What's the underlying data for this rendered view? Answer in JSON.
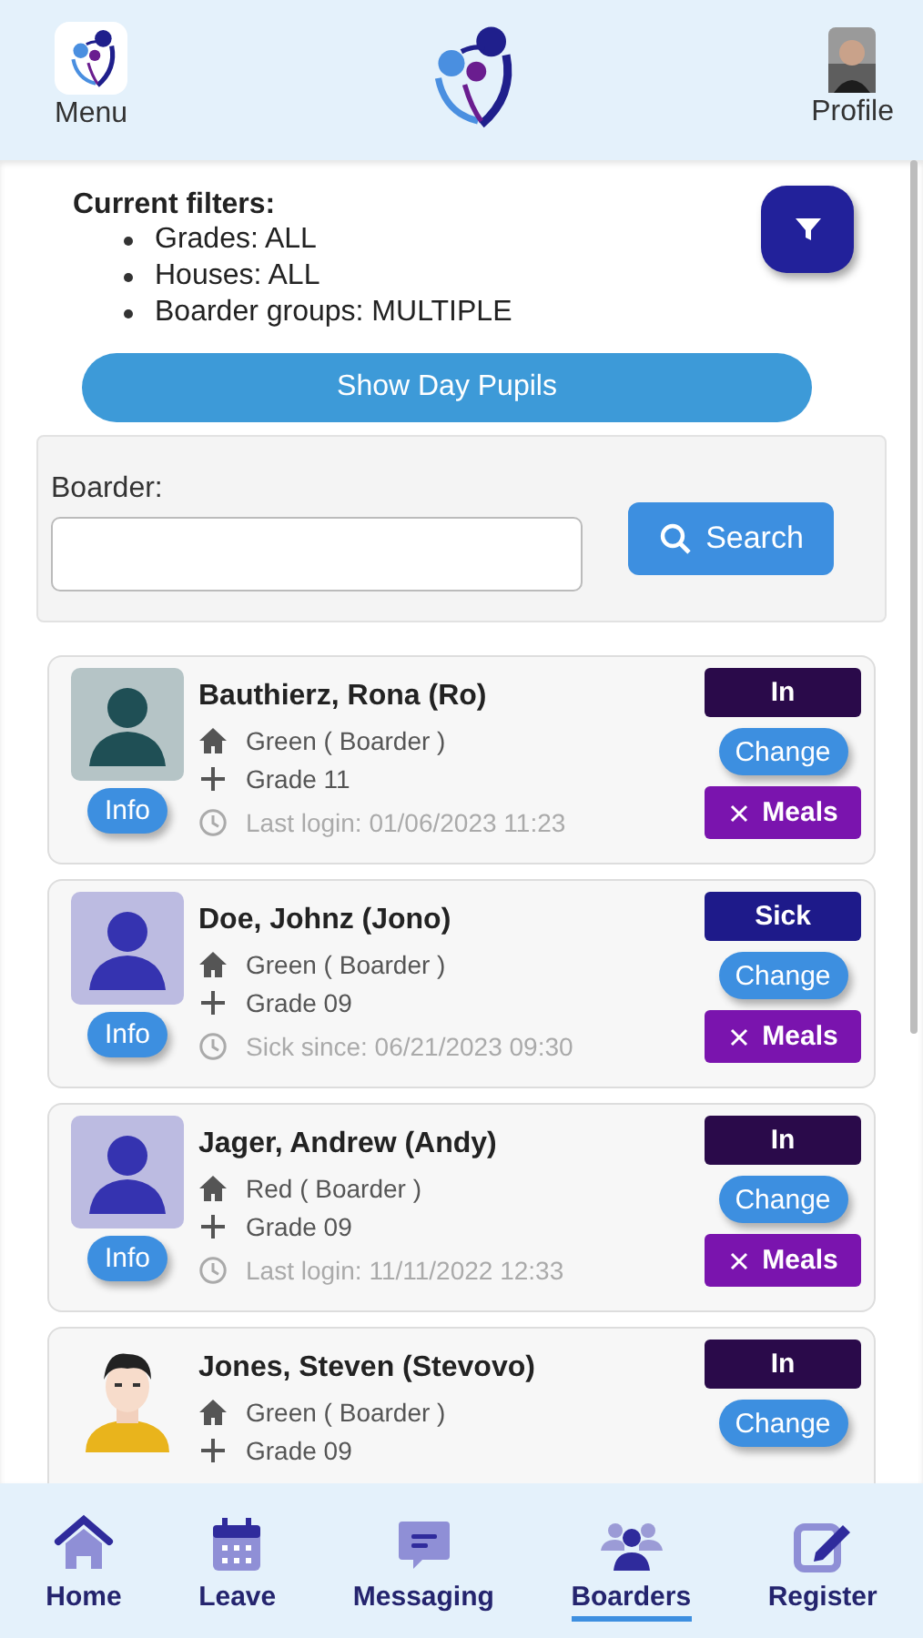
{
  "header": {
    "menu_label": "Menu",
    "profile_label": "Profile"
  },
  "filters": {
    "title": "Current filters:",
    "items": [
      "Grades: ALL",
      "Houses: ALL",
      "Boarder groups: MULTIPLE"
    ]
  },
  "day_pupils_button": "Show Day Pupils",
  "search": {
    "label": "Boarder:",
    "button": "Search"
  },
  "boarders": [
    {
      "name": "Bauthierz, Rona (Ro)",
      "avatar": {
        "kind": "placeholder",
        "color": "#1f4f55"
      },
      "house": "Green ( Boarder )",
      "grade": "Grade 11",
      "info": "Info",
      "last_line": "Last login: 01/06/2023 11:23",
      "status": {
        "text": "In",
        "color": "#2a0a4a"
      },
      "change": "Change",
      "meals": "Meals"
    },
    {
      "name": "Doe, Johnz (Jono)",
      "avatar": {
        "kind": "placeholder",
        "color": "#3533b0"
      },
      "house": "Green ( Boarder )",
      "grade": "Grade 09",
      "info": "Info",
      "last_line": "Sick since: 06/21/2023 09:30",
      "status": {
        "text": "Sick",
        "color": "#1e1a8a"
      },
      "change": "Change",
      "meals": "Meals"
    },
    {
      "name": "Jager, Andrew (Andy)",
      "avatar": {
        "kind": "placeholder",
        "color": "#3533b0"
      },
      "house": "Red ( Boarder )",
      "grade": "Grade 09",
      "info": "Info",
      "last_line": "Last login: 11/11/2022 12:33",
      "status": {
        "text": "In",
        "color": "#2a0a4a"
      },
      "change": "Change",
      "meals": "Meals"
    },
    {
      "name": "Jones, Steven (Stevovo)",
      "avatar": {
        "kind": "cartoon"
      },
      "house": "Green ( Boarder )",
      "grade": "Grade 09",
      "status": {
        "text": "In",
        "color": "#2a0a4a"
      },
      "change": "Change"
    }
  ],
  "nav": [
    {
      "label": "Home",
      "selected": false
    },
    {
      "label": "Leave",
      "selected": false
    },
    {
      "label": "Messaging",
      "selected": false
    },
    {
      "label": "Boarders",
      "selected": true
    },
    {
      "label": "Register",
      "selected": false
    }
  ]
}
